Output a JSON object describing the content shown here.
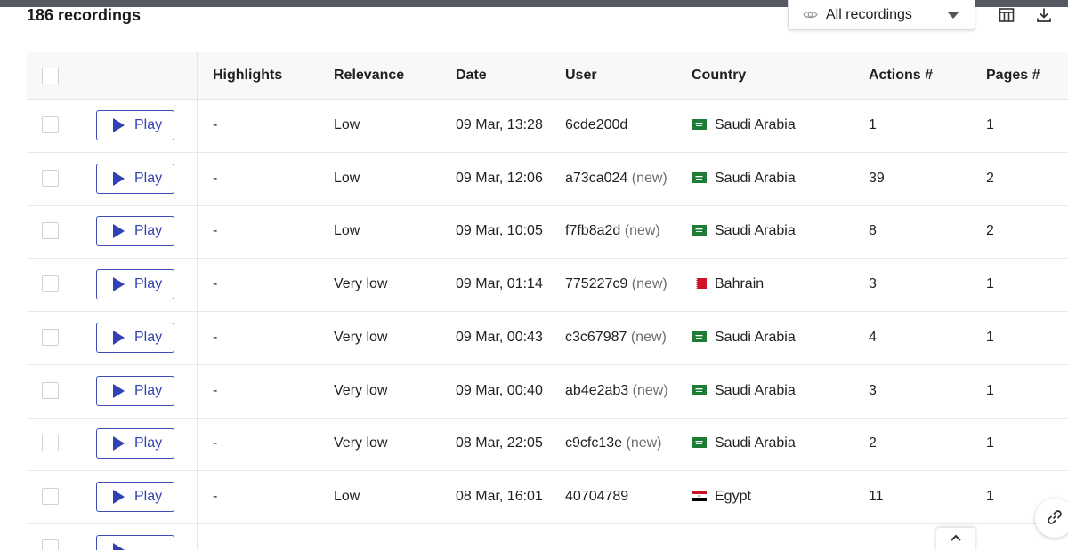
{
  "header": {
    "count_label": "186 recordings",
    "filter_label": "All recordings"
  },
  "columns": {
    "highlights": "Highlights",
    "relevance": "Relevance",
    "date": "Date",
    "user": "User",
    "country": "Country",
    "actions": "Actions #",
    "pages": "Pages #"
  },
  "play_label": "Play",
  "rows": [
    {
      "highlights": "-",
      "relevance": "Low",
      "date": "09 Mar, 13:28",
      "user": "6cde200d",
      "new": "",
      "country": "Saudi Arabia",
      "flag": "sa",
      "actions": "1",
      "pages": "1"
    },
    {
      "highlights": "-",
      "relevance": "Low",
      "date": "09 Mar, 12:06",
      "user": "a73ca024",
      "new": "(new)",
      "country": "Saudi Arabia",
      "flag": "sa",
      "actions": "39",
      "pages": "2"
    },
    {
      "highlights": "-",
      "relevance": "Low",
      "date": "09 Mar, 10:05",
      "user": "f7fb8a2d",
      "new": "(new)",
      "country": "Saudi Arabia",
      "flag": "sa",
      "actions": "8",
      "pages": "2"
    },
    {
      "highlights": "-",
      "relevance": "Very low",
      "date": "09 Mar, 01:14",
      "user": "775227c9",
      "new": "(new)",
      "country": "Bahrain",
      "flag": "bh",
      "actions": "3",
      "pages": "1"
    },
    {
      "highlights": "-",
      "relevance": "Very low",
      "date": "09 Mar, 00:43",
      "user": "c3c67987",
      "new": "(new)",
      "country": "Saudi Arabia",
      "flag": "sa",
      "actions": "4",
      "pages": "1"
    },
    {
      "highlights": "-",
      "relevance": "Very low",
      "date": "09 Mar, 00:40",
      "user": "ab4e2ab3",
      "new": "(new)",
      "country": "Saudi Arabia",
      "flag": "sa",
      "actions": "3",
      "pages": "1"
    },
    {
      "highlights": "-",
      "relevance": "Very low",
      "date": "08 Mar, 22:05",
      "user": "c9cfc13e",
      "new": "(new)",
      "country": "Saudi Arabia",
      "flag": "sa",
      "actions": "2",
      "pages": "1"
    },
    {
      "highlights": "-",
      "relevance": "Low",
      "date": "08 Mar, 16:01",
      "user": "40704789",
      "new": "",
      "country": "Egypt",
      "flag": "eg",
      "actions": "11",
      "pages": "1"
    }
  ],
  "icons": {
    "filter": "eye-icon",
    "columns": "columns-icon",
    "download": "download-icon",
    "link": "link-icon",
    "scroll_top": "chevron-up-icon"
  },
  "colors": {
    "accent": "#3141b3",
    "sa_flag": "#1e7d34",
    "bh_flag": "#ce1126",
    "eg_red": "#ce1126"
  }
}
